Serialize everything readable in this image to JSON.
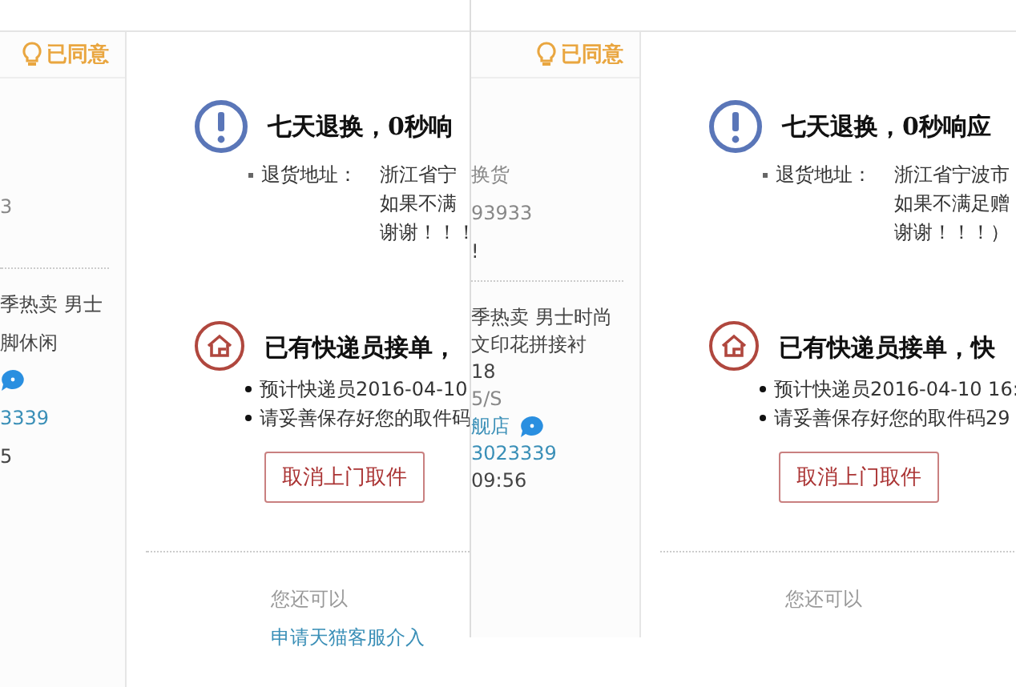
{
  "panels": [
    {
      "sidebar": {
        "header": "已同意",
        "groups": [
          [
            {
              "kind": "muted",
              "text": "3"
            }
          ],
          [
            {
              "kind": "text",
              "text": "季热卖 男士"
            },
            {
              "kind": "text",
              "text": "脚休闲"
            },
            {
              "kind": "bubble"
            },
            {
              "kind": "link",
              "text": "3339"
            },
            {
              "kind": "text",
              "text": "5"
            }
          ]
        ]
      },
      "notices": [
        {
          "kind": "alert",
          "title": "七天退换，0秒响",
          "bullets": [
            {
              "label": "退货地址：",
              "lines": [
                "浙江省宁",
                "如果不满",
                "谢谢！！！"
              ]
            }
          ]
        },
        {
          "kind": "courier",
          "title": "已有快递员接单，",
          "items": [
            "预计快递员2016-04-10",
            "请妥善保存好您的取件码"
          ],
          "button": "取消上门取件"
        }
      ],
      "more": {
        "label": "您还可以",
        "link": "申请天猫客服介入"
      }
    },
    {
      "sidebar": {
        "header": "已同意",
        "groups": [
          [
            {
              "kind": "muted",
              "text": "换货"
            },
            {
              "kind": "muted",
              "text": "93933"
            },
            {
              "kind": "text",
              "text": "!"
            }
          ],
          [
            {
              "kind": "text",
              "text": "季热卖 男士时尚"
            },
            {
              "kind": "text",
              "text": "文印花拼接衬"
            },
            {
              "kind": "text",
              "text": "18"
            },
            {
              "kind": "muted",
              "text": "5/S"
            },
            {
              "kind": "shop",
              "text": "舰店"
            },
            {
              "kind": "link",
              "text": "3023339"
            },
            {
              "kind": "text",
              "text": "09:56"
            }
          ]
        ]
      },
      "notices": [
        {
          "kind": "alert",
          "title": "七天退换，0秒响应",
          "bullets": [
            {
              "label": "退货地址：",
              "lines": [
                "浙江省宁波市",
                "如果不满足赠",
                "谢谢！！！）"
              ]
            }
          ]
        },
        {
          "kind": "courier",
          "title": "已有快递员接单，快",
          "items": [
            "预计快递员2016-04-10 16:",
            "请妥善保存好您的取件码29"
          ],
          "button": "取消上门取件"
        }
      ],
      "more": {
        "label": "您还可以"
      }
    }
  ]
}
